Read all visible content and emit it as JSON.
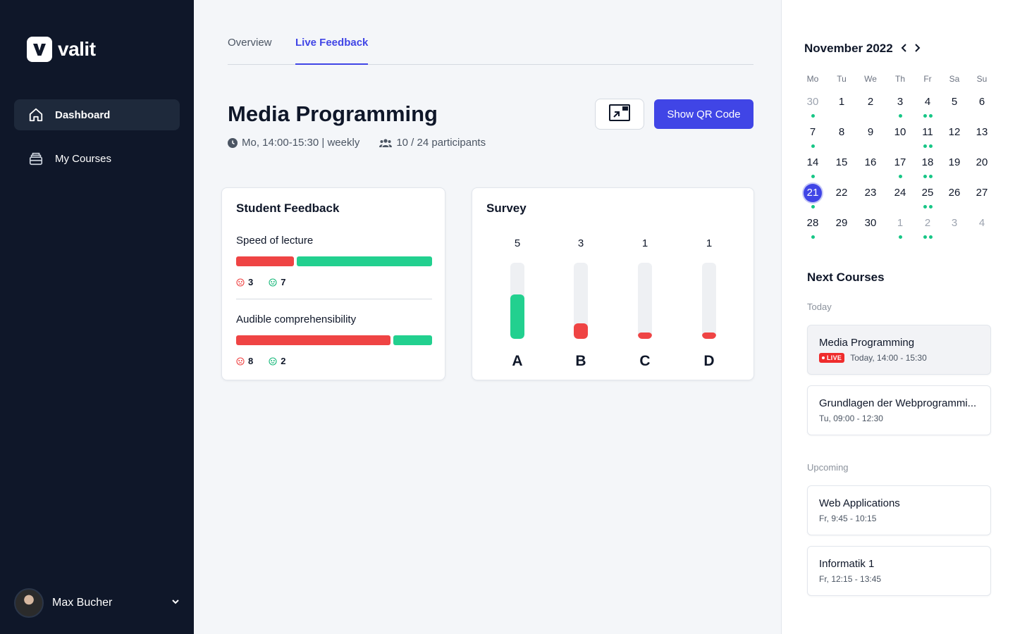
{
  "brand": {
    "name": "valit"
  },
  "sidebar": {
    "items": [
      {
        "label": "Dashboard",
        "icon": "home-icon",
        "active": true
      },
      {
        "label": "My Courses",
        "icon": "archive-icon",
        "active": false
      }
    ],
    "user": {
      "name": "Max Bucher"
    }
  },
  "tabs": [
    {
      "label": "Overview",
      "active": false
    },
    {
      "label": "Live Feedback",
      "active": true
    }
  ],
  "course": {
    "title": "Media Programming",
    "schedule": "Mo, 14:00-15:30 | weekly",
    "participants": "10 / 24 participants"
  },
  "actions": {
    "qr_label": "Show QR Code",
    "present_icon": "present-icon"
  },
  "feedback": {
    "title": "Student Feedback",
    "items": [
      {
        "label": "Speed of lecture",
        "negative": 3,
        "positive": 7
      },
      {
        "label": "Audible comprehensibility",
        "negative": 8,
        "positive": 2
      }
    ],
    "colors": {
      "negative": "#ef4444",
      "positive": "#22d08f"
    }
  },
  "survey": {
    "title": "Survey",
    "chart_data": {
      "type": "bar",
      "categories": [
        "A",
        "B",
        "C",
        "D"
      ],
      "values": [
        5,
        3,
        1,
        1
      ],
      "fill_fractions": [
        0.58,
        0.2,
        0.08,
        0.08
      ],
      "colors": [
        "#22d08f",
        "#ef4444",
        "#ef4444",
        "#ef4444"
      ]
    }
  },
  "calendar": {
    "title": "November 2022",
    "weekdays": [
      "Mo",
      "Tu",
      "We",
      "Th",
      "Fr",
      "Sa",
      "Su"
    ],
    "weeks": [
      [
        {
          "d": "30",
          "m": true,
          "dots": 1
        },
        {
          "d": "1",
          "dots": 0
        },
        {
          "d": "2",
          "dots": 0
        },
        {
          "d": "3",
          "dots": 1
        },
        {
          "d": "4",
          "dots": 2
        },
        {
          "d": "5",
          "dots": 0
        },
        {
          "d": "6",
          "dots": 0
        }
      ],
      [
        {
          "d": "7",
          "dots": 1
        },
        {
          "d": "8",
          "dots": 0
        },
        {
          "d": "9",
          "dots": 0
        },
        {
          "d": "10",
          "dots": 0
        },
        {
          "d": "11",
          "dots": 2
        },
        {
          "d": "12",
          "dots": 0
        },
        {
          "d": "13",
          "dots": 0
        }
      ],
      [
        {
          "d": "14",
          "dots": 1
        },
        {
          "d": "15",
          "dots": 0
        },
        {
          "d": "16",
          "dots": 0
        },
        {
          "d": "17",
          "dots": 1
        },
        {
          "d": "18",
          "dots": 2
        },
        {
          "d": "19",
          "dots": 0
        },
        {
          "d": "20",
          "dots": 0
        }
      ],
      [
        {
          "d": "21",
          "today": true,
          "dots": 1
        },
        {
          "d": "22",
          "dots": 0
        },
        {
          "d": "23",
          "dots": 0
        },
        {
          "d": "24",
          "dots": 0
        },
        {
          "d": "25",
          "dots": 2
        },
        {
          "d": "26",
          "dots": 0
        },
        {
          "d": "27",
          "dots": 0
        }
      ],
      [
        {
          "d": "28",
          "dots": 1
        },
        {
          "d": "29",
          "dots": 0
        },
        {
          "d": "30",
          "dots": 0
        },
        {
          "d": "1",
          "m": true,
          "dots": 1
        },
        {
          "d": "2",
          "m": true,
          "dots": 2
        },
        {
          "d": "3",
          "m": true,
          "dots": 0
        },
        {
          "d": "4",
          "m": true,
          "dots": 0
        }
      ]
    ]
  },
  "next_courses": {
    "title": "Next Courses",
    "today_label": "Today",
    "upcoming_label": "Upcoming",
    "today": [
      {
        "name": "Media Programming",
        "time": "Today, 14:00 - 15:30",
        "live": true,
        "live_label": "LIVE"
      },
      {
        "name": "Grundlagen der Webprogrammi...",
        "time": "Tu, 09:00 - 12:30",
        "live": false
      }
    ],
    "upcoming": [
      {
        "name": "Web Applications",
        "time": "Fr, 9:45 - 10:15"
      },
      {
        "name": "Informatik 1",
        "time": "Fr, 12:15 - 13:45"
      }
    ]
  }
}
